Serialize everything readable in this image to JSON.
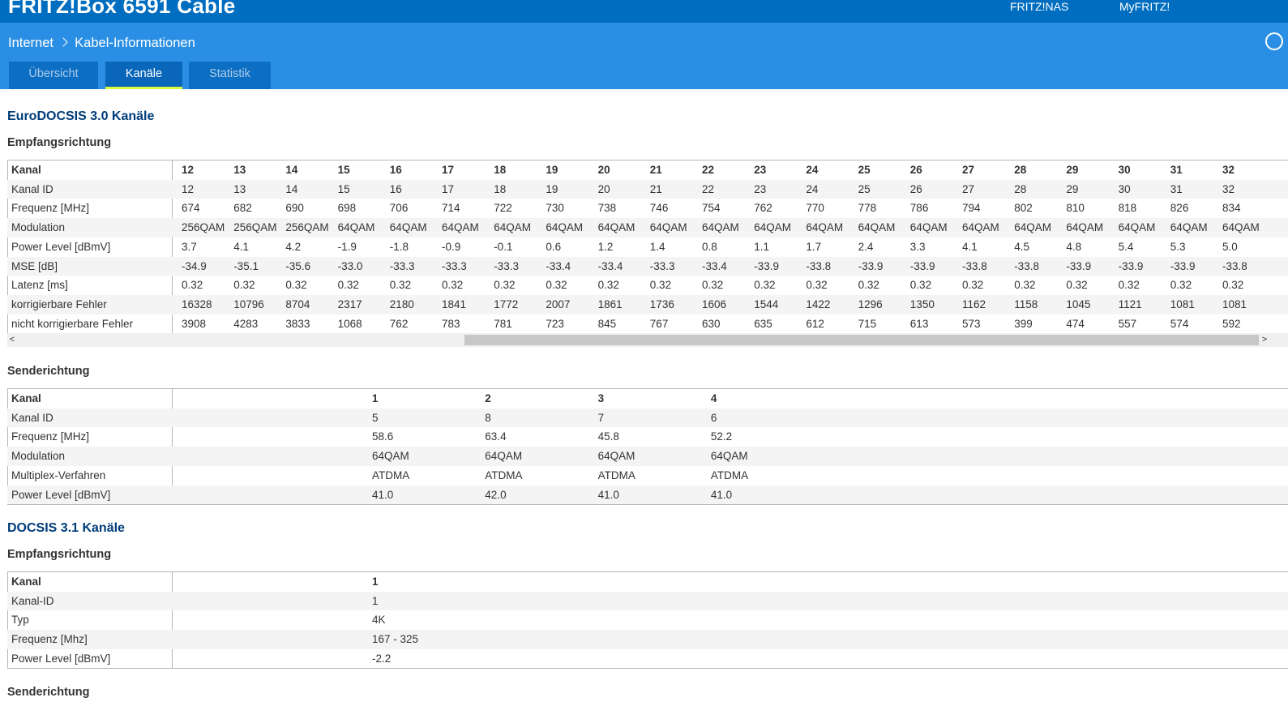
{
  "header": {
    "brand": "FRITZ!Box 6591 Cable",
    "links": [
      "FRITZ!NAS",
      "MyFRITZ!"
    ]
  },
  "breadcrumb": {
    "parent": "Internet",
    "current": "Kabel-Informationen"
  },
  "tabs": [
    {
      "label": "Übersicht",
      "active": false
    },
    {
      "label": "Kanäle",
      "active": true
    },
    {
      "label": "Statistik",
      "active": false
    }
  ],
  "docsis30": {
    "title": "EuroDOCSIS 3.0 Kanäle",
    "downstream": {
      "title": "Empfangsrichtung",
      "header_label": "Kanal",
      "columns": [
        "12",
        "13",
        "14",
        "15",
        "16",
        "17",
        "18",
        "19",
        "20",
        "21",
        "22",
        "23",
        "24",
        "25",
        "26",
        "27",
        "28",
        "29",
        "30",
        "31",
        "32"
      ],
      "rows": [
        {
          "label": "Kanal ID",
          "values": [
            "12",
            "13",
            "14",
            "15",
            "16",
            "17",
            "18",
            "19",
            "20",
            "21",
            "22",
            "23",
            "24",
            "25",
            "26",
            "27",
            "28",
            "29",
            "30",
            "31",
            "32"
          ]
        },
        {
          "label": "Frequenz [MHz]",
          "values": [
            "674",
            "682",
            "690",
            "698",
            "706",
            "714",
            "722",
            "730",
            "738",
            "746",
            "754",
            "762",
            "770",
            "778",
            "786",
            "794",
            "802",
            "810",
            "818",
            "826",
            "834"
          ]
        },
        {
          "label": "Modulation",
          "values": [
            "256QAM",
            "256QAM",
            "256QAM",
            "64QAM",
            "64QAM",
            "64QAM",
            "64QAM",
            "64QAM",
            "64QAM",
            "64QAM",
            "64QAM",
            "64QAM",
            "64QAM",
            "64QAM",
            "64QAM",
            "64QAM",
            "64QAM",
            "64QAM",
            "64QAM",
            "64QAM",
            "64QAM"
          ]
        },
        {
          "label": "Power Level [dBmV]",
          "values": [
            "3.7",
            "4.1",
            "4.2",
            "-1.9",
            "-1.8",
            "-0.9",
            "-0.1",
            "0.6",
            "1.2",
            "1.4",
            "0.8",
            "1.1",
            "1.7",
            "2.4",
            "3.3",
            "4.1",
            "4.5",
            "4.8",
            "5.4",
            "5.3",
            "5.0"
          ]
        },
        {
          "label": "MSE [dB]",
          "values": [
            "-34.9",
            "-35.1",
            "-35.6",
            "-33.0",
            "-33.3",
            "-33.3",
            "-33.3",
            "-33.4",
            "-33.4",
            "-33.3",
            "-33.4",
            "-33.9",
            "-33.8",
            "-33.9",
            "-33.9",
            "-33.8",
            "-33.8",
            "-33.9",
            "-33.9",
            "-33.9",
            "-33.8"
          ]
        },
        {
          "label": "Latenz [ms]",
          "values": [
            "0.32",
            "0.32",
            "0.32",
            "0.32",
            "0.32",
            "0.32",
            "0.32",
            "0.32",
            "0.32",
            "0.32",
            "0.32",
            "0.32",
            "0.32",
            "0.32",
            "0.32",
            "0.32",
            "0.32",
            "0.32",
            "0.32",
            "0.32",
            "0.32"
          ]
        },
        {
          "label": "korrigierbare Fehler",
          "values": [
            "16328",
            "10796",
            "8704",
            "2317",
            "2180",
            "1841",
            "1772",
            "2007",
            "1861",
            "1736",
            "1606",
            "1544",
            "1422",
            "1296",
            "1350",
            "1162",
            "1158",
            "1045",
            "1121",
            "1081",
            "1081"
          ]
        },
        {
          "label": "nicht korrigierbare Fehler",
          "values": [
            "3908",
            "4283",
            "3833",
            "1068",
            "762",
            "783",
            "781",
            "723",
            "845",
            "767",
            "630",
            "635",
            "612",
            "715",
            "613",
            "573",
            "399",
            "474",
            "557",
            "574",
            "592"
          ]
        }
      ]
    },
    "upstream": {
      "title": "Senderichtung",
      "header_label": "Kanal",
      "columns": [
        "1",
        "2",
        "3",
        "4"
      ],
      "rows": [
        {
          "label": "Kanal ID",
          "values": [
            "5",
            "8",
            "7",
            "6"
          ]
        },
        {
          "label": "Frequenz [MHz]",
          "values": [
            "58.6",
            "63.4",
            "45.8",
            "52.2"
          ]
        },
        {
          "label": "Modulation",
          "values": [
            "64QAM",
            "64QAM",
            "64QAM",
            "64QAM"
          ]
        },
        {
          "label": "Multiplex-Verfahren",
          "values": [
            "ATDMA",
            "ATDMA",
            "ATDMA",
            "ATDMA"
          ]
        },
        {
          "label": "Power Level [dBmV]",
          "values": [
            "41.0",
            "42.0",
            "41.0",
            "41.0"
          ]
        }
      ]
    }
  },
  "docsis31": {
    "title": "DOCSIS 3.1 Kanäle",
    "downstream": {
      "title": "Empfangsrichtung",
      "header_label": "Kanal",
      "columns": [
        "1"
      ],
      "rows": [
        {
          "label": "Kanal-ID",
          "values": [
            "1"
          ]
        },
        {
          "label": "Typ",
          "values": [
            "4K"
          ]
        },
        {
          "label": "Frequenz [Mhz]",
          "values": [
            "167 - 325"
          ]
        },
        {
          "label": "Power Level [dBmV]",
          "values": [
            "-2.2"
          ]
        }
      ]
    },
    "upstream_title": "Senderichtung"
  },
  "scrollbar": {
    "left_arrow": "<",
    "right_arrow": ">"
  }
}
